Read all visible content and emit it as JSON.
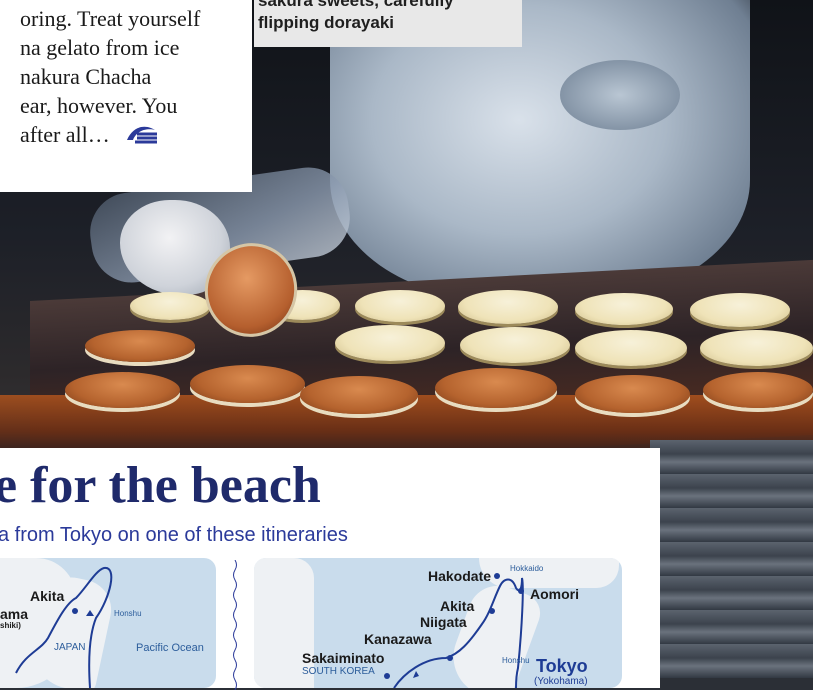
{
  "intro_text": {
    "lines": [
      "oring. Treat yourself",
      "na gelato from ice",
      "nakura Chacha",
      "ear, however. You",
      "after all…"
    ],
    "logo": "princess-wave-icon"
  },
  "photo_caption": {
    "lines": [
      "sakura sweets, carefully",
      "flipping dorayaki"
    ]
  },
  "feature": {
    "headline": "e for the beach",
    "subhead": "a from Tokyo on one of these itineraries"
  },
  "map_left": {
    "ports": [
      "Akita",
      "ama"
    ],
    "small_labels": [
      "shiki)",
      "Honshu",
      "JAPAN"
    ],
    "ocean": "Pacific Ocean"
  },
  "map_right": {
    "ports": [
      "Hakodate",
      "Aomori",
      "Akita",
      "Niigata",
      "Kanazawa",
      "Sakaiminato"
    ],
    "small_labels": [
      "Hokkaido",
      "Honshu"
    ],
    "country": "SOUTH KOREA",
    "destination": "Tokyo",
    "destination_sub": "(Yokohama)"
  },
  "colors": {
    "headline": "#1f2a6b",
    "accent_blue": "#2b3a9a",
    "map_water": "#c9dcec",
    "map_land": "#eef1f4"
  }
}
